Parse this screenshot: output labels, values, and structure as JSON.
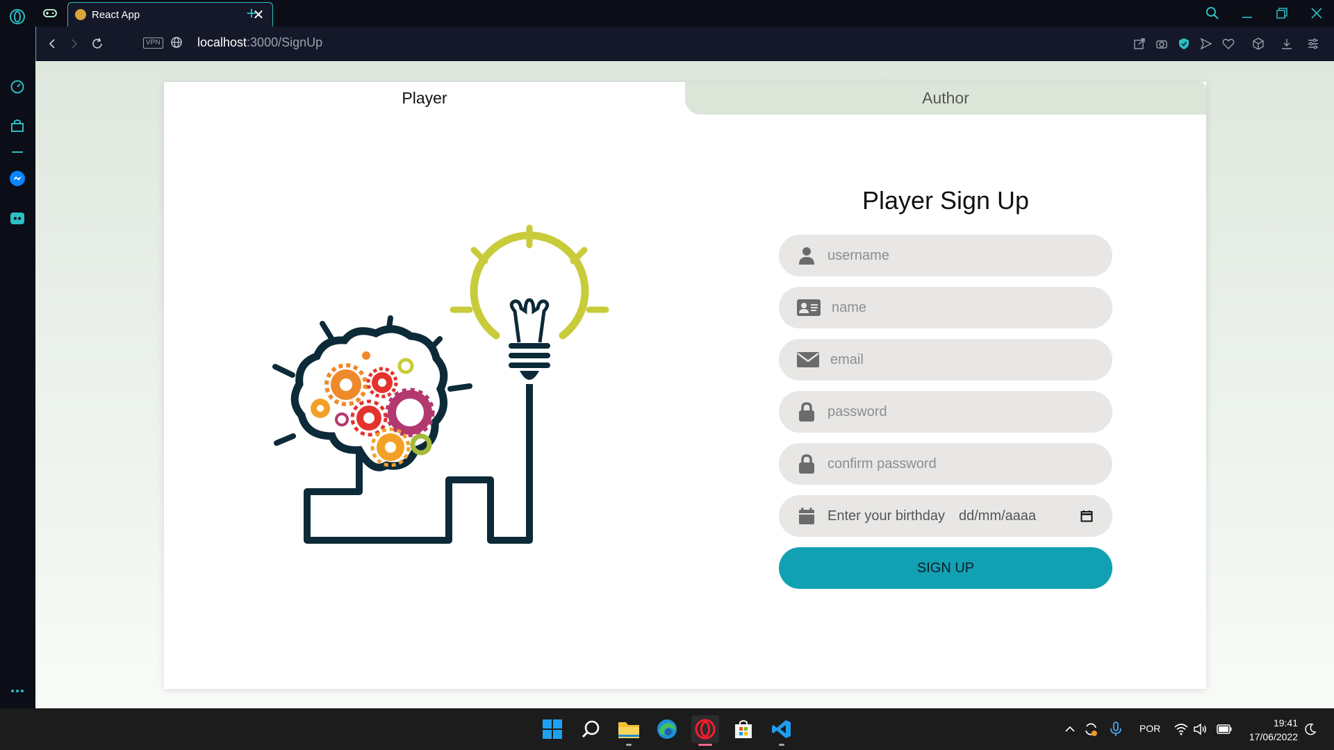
{
  "browser": {
    "tab_title": "React App",
    "tab_close": "✕",
    "new_tab": "+",
    "vpn": "VPN",
    "url_host": "localhost",
    "url_path": ":3000/SignUp"
  },
  "page": {
    "tabs": [
      "Player",
      "Author"
    ],
    "title": "Player Sign Up",
    "fields": {
      "username": "username",
      "name": "name",
      "email": "email",
      "password": "password",
      "confirm_password": "confirm password"
    },
    "birthday_label": "Enter your birthday",
    "birthday_value": "dd/mm/aaaa",
    "signup_button": "SIGN UP",
    "accent_color": "#12a1b3"
  },
  "taskbar": {
    "language": "POR",
    "time": "19:41",
    "date": "17/06/2022"
  },
  "icons": [
    "opera-logo-icon",
    "speed-dial-icon",
    "shopping-icon",
    "messenger-icon",
    "discord-icon",
    "more-icon",
    "game-icon",
    "search-icon",
    "minimize-icon",
    "restore-icon",
    "close-icon",
    "back-icon",
    "forward-icon",
    "reload-icon",
    "globe-icon",
    "share-icon",
    "camera-icon",
    "shield-icon",
    "send-icon",
    "heart-icon",
    "cube-icon",
    "download-icon",
    "settings-icon",
    "user-icon",
    "id-card-icon",
    "envelope-icon",
    "lock-icon",
    "calendar-icon",
    "windows-start-icon",
    "file-explorer-icon",
    "edge-icon",
    "opera-icon",
    "store-icon",
    "vscode-icon"
  ]
}
